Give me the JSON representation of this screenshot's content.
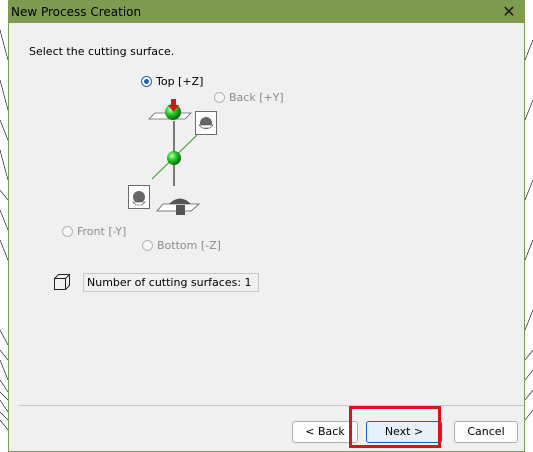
{
  "window": {
    "title": "New Process Creation",
    "close_glyph": "✕"
  },
  "instruction": "Select the cutting surface.",
  "options": {
    "top": {
      "label": "Top [+Z]",
      "checked": true
    },
    "back": {
      "label": "Back [+Y]",
      "checked": false
    },
    "front": {
      "label": "Front [-Y]",
      "checked": false
    },
    "bottom": {
      "label": "Bottom [-Z]",
      "checked": false
    }
  },
  "summary": {
    "field_text": "Number of cutting surfaces: 1",
    "icon": "box-outline-icon"
  },
  "buttons": {
    "back": "< Back",
    "next": "Next >",
    "cancel": "Cancel"
  },
  "colors": {
    "titlebar": "#7e9b50",
    "highlight": "#e0101a",
    "sphere": "#2ecc2e",
    "arrow": "#d01818"
  }
}
